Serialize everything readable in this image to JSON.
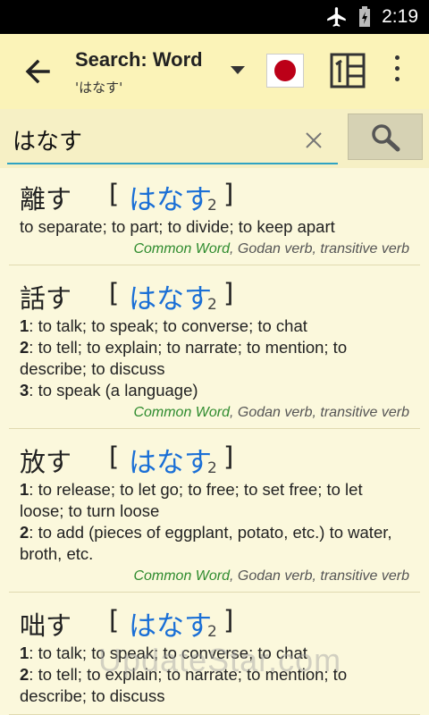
{
  "status": {
    "time": "2:19"
  },
  "toolbar": {
    "title": "Search: Word",
    "subtitle": "'はなす'"
  },
  "search": {
    "value": "はなす"
  },
  "entries": [
    {
      "kanji": "離す",
      "bracket_open": "[",
      "kana": "はなす",
      "sub": "2",
      "bracket_close": "]",
      "senses": [
        {
          "num": "",
          "text": "to separate; to part; to divide; to keep apart"
        }
      ],
      "tag_common": "Common Word",
      "tag_rest": ", Godan verb, transitive verb"
    },
    {
      "kanji": "話す",
      "bracket_open": "[",
      "kana": "はなす",
      "sub": "2",
      "bracket_close": "]",
      "senses": [
        {
          "num": "1",
          "text": ": to talk; to speak; to converse; to chat"
        },
        {
          "num": "2",
          "text": ": to tell; to explain; to narrate; to mention; to describe; to discuss"
        },
        {
          "num": "3",
          "text": ": to speak (a language)"
        }
      ],
      "tag_common": "Common Word",
      "tag_rest": ", Godan verb, transitive verb"
    },
    {
      "kanji": "放す",
      "bracket_open": "[",
      "kana": "はなす",
      "sub": "2",
      "bracket_close": "]",
      "senses": [
        {
          "num": "1",
          "text": ": to release; to let go; to free; to set free; to let loose; to turn loose"
        },
        {
          "num": "2",
          "text": ": to add (pieces of eggplant, potato, etc.) to water, broth, etc."
        }
      ],
      "tag_common": "Common Word",
      "tag_rest": ", Godan verb, transitive verb"
    },
    {
      "kanji": "咄す",
      "bracket_open": "[",
      "kana": "はなす",
      "sub": "2",
      "bracket_close": "]",
      "senses": [
        {
          "num": "1",
          "text": ": to talk; to speak; to converse; to chat"
        },
        {
          "num": "2",
          "text": ": to tell; to explain; to narrate; to mention; to describe; to discuss"
        }
      ],
      "tag_common": "",
      "tag_rest": ""
    }
  ],
  "watermark": "UpdateStar.com",
  "colors": {
    "toolbar_bg": "#fbf3b8",
    "kana": "#1a6fd6",
    "common_tag": "#2e8b2e",
    "search_underline": "#2fa3c3",
    "flag_red": "#bc0018"
  },
  "icons": {
    "back": "arrow-left-icon",
    "dropdown": "triangle-down-icon",
    "flag": "japan-flag-icon",
    "layout": "split-layout-icon",
    "overflow": "more-vert-icon",
    "clear": "close-icon",
    "search": "search-icon",
    "airplane": "airplane-mode-icon",
    "battery": "battery-charging-icon"
  }
}
